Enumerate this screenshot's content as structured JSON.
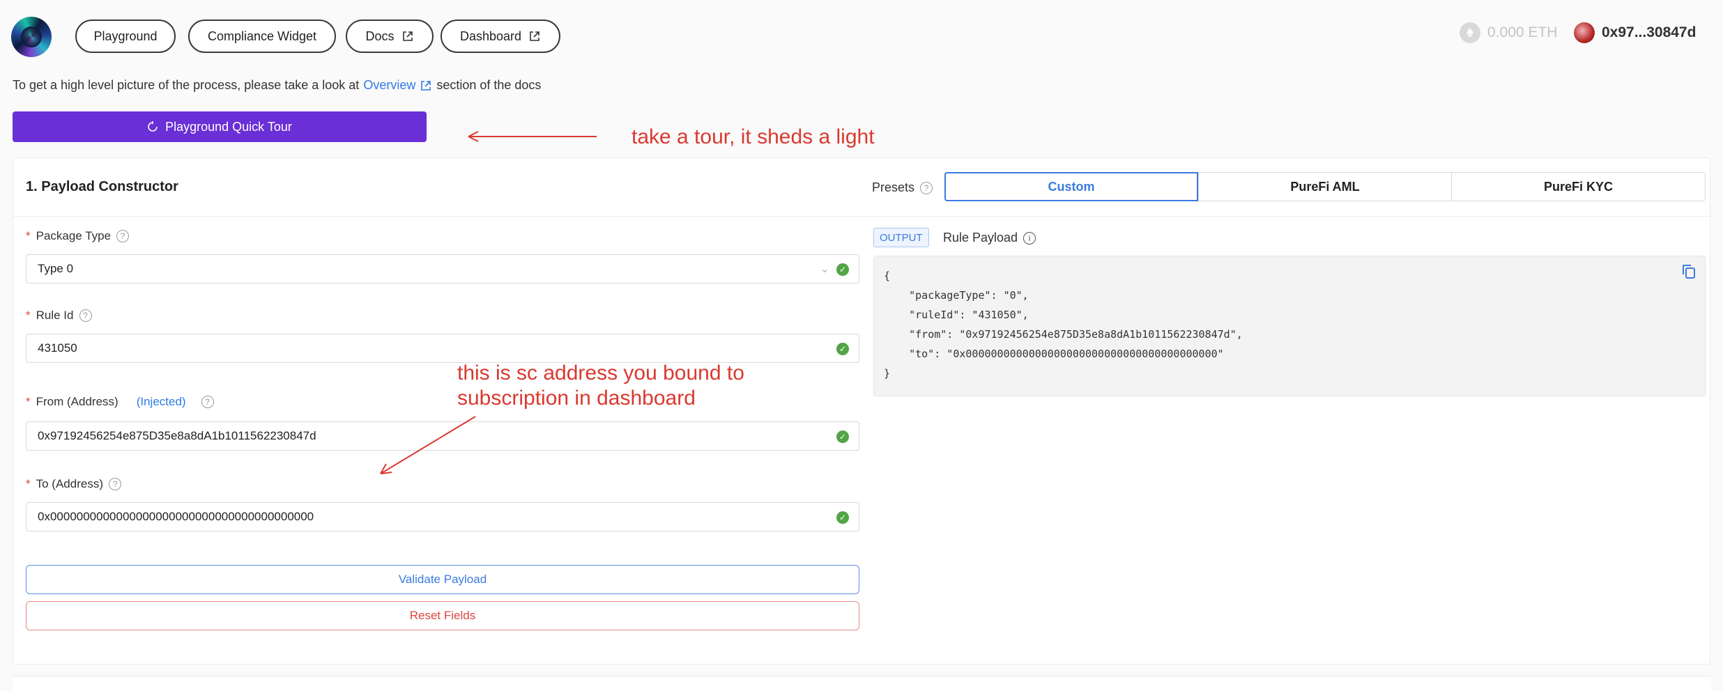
{
  "header": {
    "nav": [
      {
        "label": "Playground",
        "external": false
      },
      {
        "label": "Compliance Widget",
        "external": false
      },
      {
        "label": "Docs",
        "external": true
      },
      {
        "label": "Dashboard",
        "external": true
      }
    ],
    "balance": "0.000 ETH",
    "account": "0x97...30847d"
  },
  "intro": {
    "before": "To get a high level picture of the process, please take a look at",
    "link": "Overview",
    "after": "section of the docs"
  },
  "tour_button": "Playground Quick Tour",
  "annotations": {
    "tour": "take a tour, it sheds a light",
    "address_line1": "this is sc address you bound to",
    "address_line2": "subscription in dashboard"
  },
  "constructor": {
    "title": "1. Payload Constructor",
    "presets_label": "Presets",
    "presets": [
      "Custom",
      "PureFi AML",
      "PureFi KYC"
    ],
    "active_preset": "Custom",
    "fields": {
      "package_type": {
        "label": "Package Type",
        "value": "Type 0"
      },
      "rule_id": {
        "label": "Rule Id",
        "value": "431050"
      },
      "from": {
        "label": "From (Address)",
        "note": "(Injected)",
        "value": "0x97192456254e875D35e8a8dA1b1011562230847d"
      },
      "to": {
        "label": "To (Address)",
        "value": "0x0000000000000000000000000000000000000000"
      }
    },
    "validate_label": "Validate Payload",
    "reset_label": "Reset Fields"
  },
  "output": {
    "tag": "OUTPUT",
    "title": "Rule Payload",
    "lines": [
      "{",
      "    \"packageType\": \"0\",",
      "    \"ruleId\": \"431050\",",
      "    \"from\": \"0x97192456254e875D35e8a8dA1b1011562230847d\",",
      "    \"to\": \"0x0000000000000000000000000000000000000000\"",
      "}"
    ]
  },
  "colors": {
    "primary_purple": "#6a2fd6",
    "link_blue": "#2f7ae5",
    "annotation_red": "#d9392f",
    "success_green": "#52a447"
  }
}
